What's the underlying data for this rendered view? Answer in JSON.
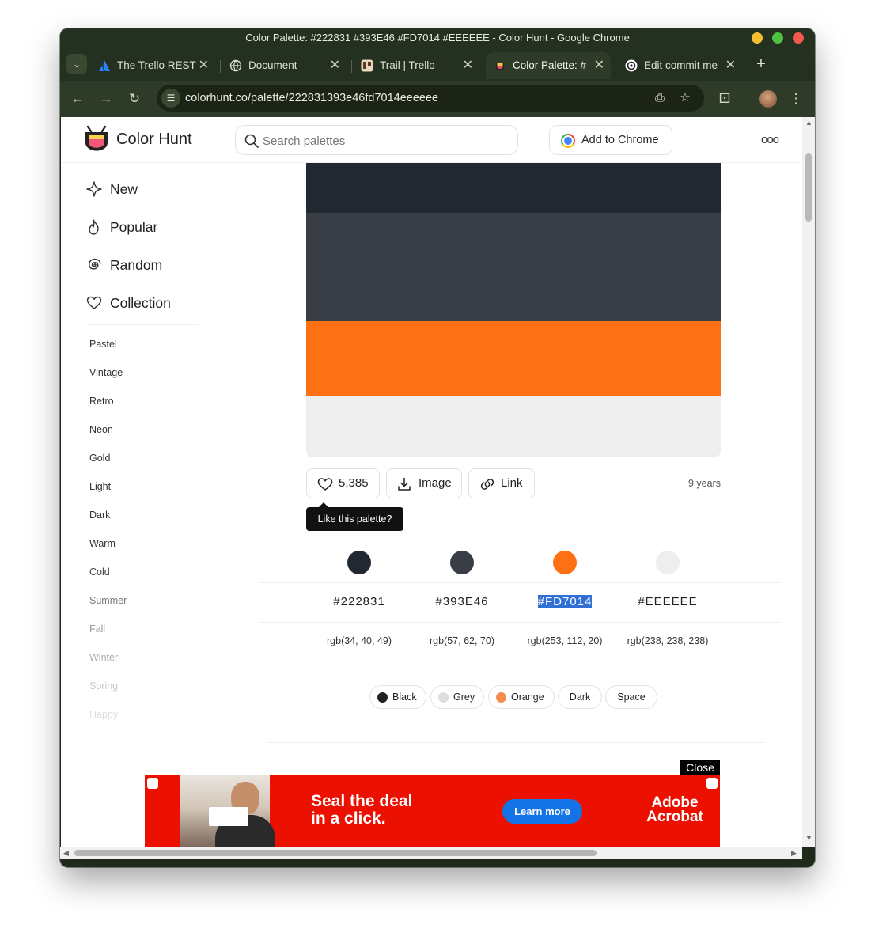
{
  "window": {
    "title": "Color Palette: #222831 #393E46 #FD7014 #EEEEEE - Color Hunt - Google Chrome"
  },
  "tabs": [
    {
      "label": "The Trello REST",
      "icon": "atlassian-icon"
    },
    {
      "label": "Document",
      "icon": "globe-icon"
    },
    {
      "label": "Trail | Trello",
      "icon": "trello-icon"
    },
    {
      "label": "Color Palette: #",
      "icon": "colorhunt-icon",
      "active": true
    },
    {
      "label": "Edit commit me",
      "icon": "openai-icon"
    }
  ],
  "address": {
    "url": "colorhunt.co/palette/222831393e46fd7014eeeeee"
  },
  "site": {
    "brand": "Color Hunt",
    "search_placeholder": "Search palettes",
    "add_to_chrome": "Add to Chrome",
    "more": "ooo"
  },
  "sidebar": {
    "main": [
      {
        "label": "New",
        "icon": "sparkle-icon"
      },
      {
        "label": "Popular",
        "icon": "flame-icon"
      },
      {
        "label": "Random",
        "icon": "spiral-icon"
      },
      {
        "label": "Collection",
        "icon": "heart-icon"
      }
    ],
    "tags": [
      "Pastel",
      "Vintage",
      "Retro",
      "Neon",
      "Gold",
      "Light",
      "Dark",
      "Warm",
      "Cold",
      "Summer",
      "Fall",
      "Winter",
      "Spring",
      "Happy"
    ]
  },
  "palette": {
    "colors": [
      {
        "hex": "#222831",
        "rgb": "rgb(34, 40, 49)"
      },
      {
        "hex": "#393E46",
        "rgb": "rgb(57, 62, 70)"
      },
      {
        "hex": "#FD7014",
        "rgb": "rgb(253, 112, 20)"
      },
      {
        "hex": "#EEEEEE",
        "rgb": "rgb(238, 238, 238)"
      }
    ],
    "likes": "5,385",
    "image_label": "Image",
    "link_label": "Link",
    "age": "9 years",
    "tooltip": "Like this palette?",
    "tags": [
      {
        "label": "Black",
        "color": "#222222"
      },
      {
        "label": "Grey",
        "color": "#dddddd"
      },
      {
        "label": "Orange",
        "color": "#f58b4c"
      },
      {
        "label": "Dark"
      },
      {
        "label": "Space"
      }
    ]
  },
  "ad": {
    "close": "Close",
    "headline_1": "Seal the deal",
    "headline_2": "in a click.",
    "cta": "Learn more",
    "brand_1": "Adobe",
    "brand_2": "Acrobat"
  }
}
